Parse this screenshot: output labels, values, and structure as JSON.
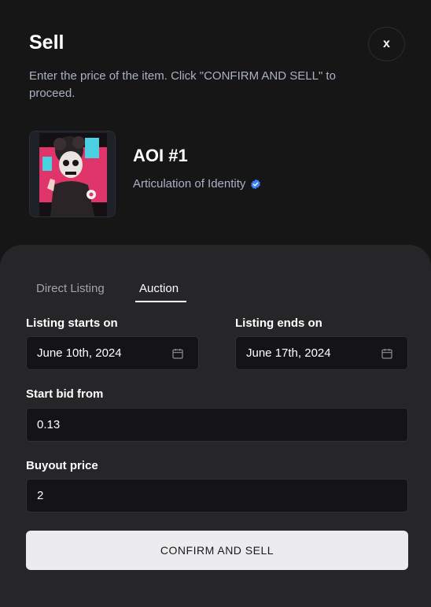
{
  "header": {
    "title": "Sell",
    "close_label": "x",
    "subtitle": "Enter the price of the item. Click \"CONFIRM AND SELL\" to proceed."
  },
  "item": {
    "name": "AOI #1",
    "collection": "Articulation of Identity",
    "verified_icon": "verified-badge-icon",
    "thumbnail_icon": "nft-artwork-skull-character"
  },
  "tabs": [
    {
      "label": "Direct Listing",
      "active": false
    },
    {
      "label": "Auction",
      "active": true
    }
  ],
  "form": {
    "listing_starts": {
      "label": "Listing starts on",
      "value": "June 10th, 2024",
      "icon": "calendar-icon"
    },
    "listing_ends": {
      "label": "Listing ends on",
      "value": "June 17th, 2024",
      "icon": "calendar-icon"
    },
    "start_bid": {
      "label": "Start bid from",
      "value": "0.13"
    },
    "buyout_price": {
      "label": "Buyout price",
      "value": "2"
    }
  },
  "actions": {
    "confirm_label": "CONFIRM AND SELL"
  },
  "colors": {
    "background": "#161617",
    "panel": "#262628",
    "input_bg": "#141416",
    "muted_text": "#a9b1c4",
    "verified_blue": "#3b82f6",
    "confirm_bg": "#ececee"
  }
}
